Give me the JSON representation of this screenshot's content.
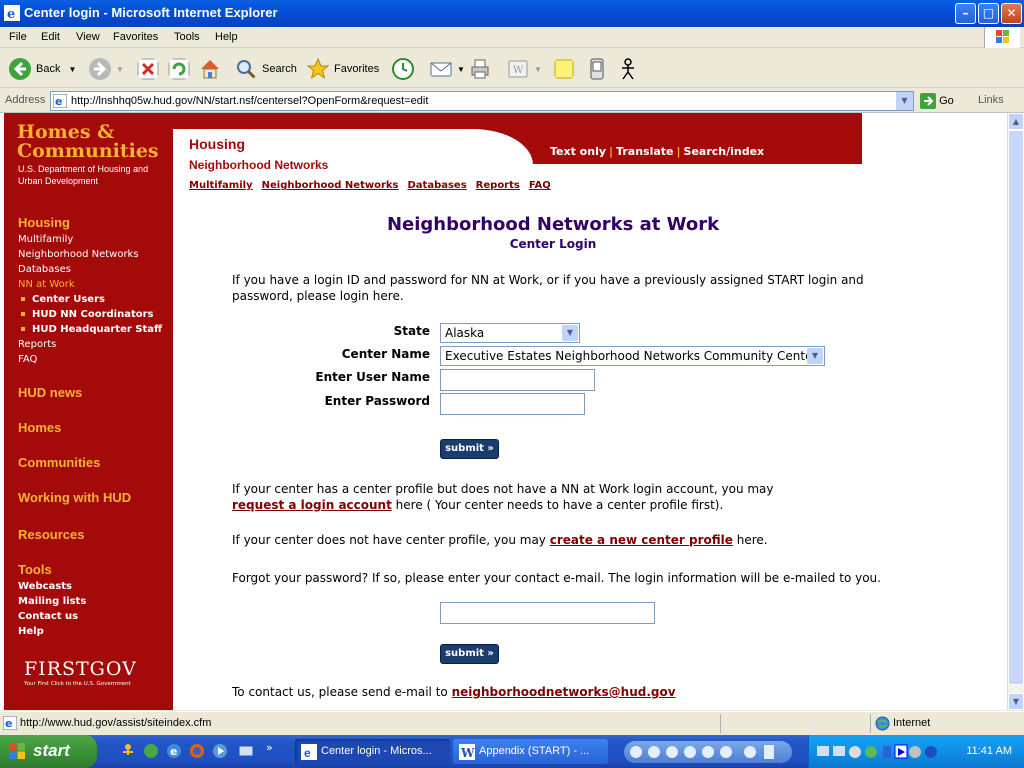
{
  "window": {
    "title": "Center login - Microsoft Internet Explorer",
    "min": "–",
    "max": "□",
    "close": "✕"
  },
  "menu": [
    "File",
    "Edit",
    "View",
    "Favorites",
    "Tools",
    "Help"
  ],
  "toolbar": {
    "back": "Back",
    "search": "Search",
    "favorites": "Favorites"
  },
  "address": {
    "label": "Address",
    "url": "http://lnshhq05w.hud.gov/NN/start.nsf/centersel?OpenForm&request=edit",
    "go": "Go",
    "links": "Links"
  },
  "sidebar": {
    "logo_line1": "Homes &",
    "logo_line2": "Communities",
    "logo_sub": "U.S. Department of Housing and Urban Development",
    "housing": "Housing",
    "housing_links": [
      "Multifamily",
      "Neighborhood Networks",
      "Databases"
    ],
    "nn_at_work": "NN at Work",
    "nn_sub": [
      "Center Users",
      "HUD NN Coordinators",
      "HUD Headquarter Staff"
    ],
    "housing_links2": [
      "Reports",
      "FAQ"
    ],
    "sections": [
      "HUD news",
      "Homes",
      "Communities",
      "Working with HUD",
      "Resources",
      "Tools"
    ],
    "tools_links": [
      "Webcasts",
      "Mailing lists",
      "Contact us",
      "Help"
    ],
    "firstgov": "FIRSTGOV",
    "firstgov_tag": "Your First Click to the U.S. Government"
  },
  "header": {
    "section": "Housing",
    "subsection": "Neighborhood Networks",
    "toplinks": [
      "Text only",
      "Translate",
      "Search/index"
    ],
    "subnav": [
      "Multifamily",
      "Neighborhood Networks",
      "Databases",
      "Reports",
      "FAQ"
    ]
  },
  "main": {
    "title": "Neighborhood Networks at Work",
    "subtitle": "Center Login",
    "intro": "If you have a login ID and password for NN at Work, or if you have a previously assigned START login and password, please login here.",
    "state_label": "State",
    "state_value": "Alaska",
    "center_label": "Center Name",
    "center_value": "Executive Estates Neighborhood Networks Community Center",
    "user_label": "Enter User Name",
    "pass_label": "Enter Password",
    "submit": "submit »",
    "profile_text1": "If your center has a center profile but does not have a NN at Work login account, you may",
    "profile_link": "request a login account",
    "profile_text2": " here ( Your center needs to have a center profile first).",
    "noprofile_text1": "If your center does not have center profile, you may ",
    "noprofile_link": "create a new center profile",
    "noprofile_text2": " here.",
    "forgot": "Forgot your password? If so, please enter your contact e-mail. The login information will be e-mailed to you.",
    "contact_text": "To contact us, please send e-mail to ",
    "contact_email": "neighborhoodnetworks@hud.gov"
  },
  "status": {
    "text": "http://www.hud.gov/assist/siteindex.cfm",
    "zone": "Internet"
  },
  "taskbar": {
    "start": "start",
    "tasks": [
      "Center login - Micros...",
      "Appendix (START) - ..."
    ],
    "clock": "11:41 AM"
  },
  "colors": {
    "hud_red": "#A50A0A",
    "hud_gold": "#F9B233",
    "title_purple": "#330066",
    "link_maroon": "#800000"
  }
}
